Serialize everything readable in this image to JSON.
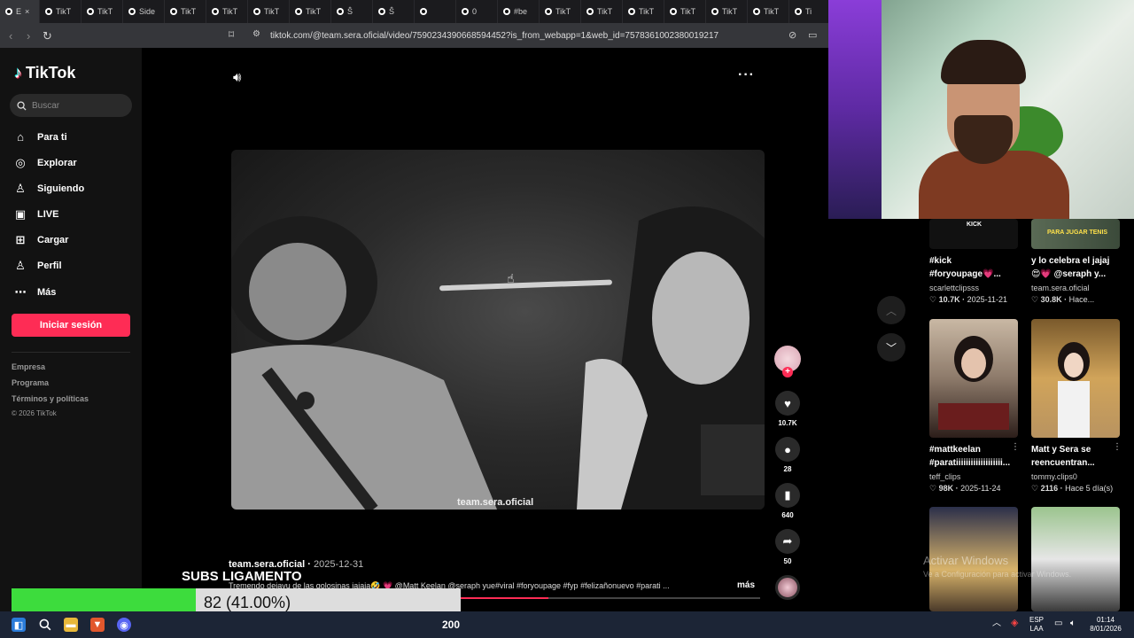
{
  "browser": {
    "tabs": [
      {
        "label": "E",
        "active": true
      },
      {
        "label": "TikT"
      },
      {
        "label": "TikT"
      },
      {
        "label": "Side"
      },
      {
        "label": "TikT"
      },
      {
        "label": "TikT"
      },
      {
        "label": "TikT"
      },
      {
        "label": "TikT"
      },
      {
        "label": "Ŝ"
      },
      {
        "label": "Ŝ"
      },
      {
        "label": ""
      },
      {
        "label": "0"
      },
      {
        "label": "#be"
      },
      {
        "label": "TikT"
      },
      {
        "label": "TikT"
      },
      {
        "label": "TikT"
      },
      {
        "label": "TikT"
      },
      {
        "label": "TikT"
      },
      {
        "label": "TikT"
      },
      {
        "label": "Ti"
      }
    ],
    "url": "tiktok.com/@team.sera.oficial/video/7590234390668594452?is_from_webapp=1&web_id=7578361002380019217"
  },
  "sidebar": {
    "logo": "TikTok",
    "search_placeholder": "Buscar",
    "nav": [
      {
        "label": "Para ti",
        "icon": "home-icon"
      },
      {
        "label": "Explorar",
        "icon": "compass-icon"
      },
      {
        "label": "Siguiendo",
        "icon": "following-icon"
      },
      {
        "label": "LIVE",
        "icon": "live-icon"
      },
      {
        "label": "Cargar",
        "icon": "upload-icon"
      },
      {
        "label": "Perfil",
        "icon": "profile-icon"
      },
      {
        "label": "Más",
        "icon": "more-icon"
      }
    ],
    "login_label": "Iniciar sesión",
    "footer_links": [
      "Empresa",
      "Programa",
      "Términos y políticas"
    ],
    "copyright": "© 2026 TikTok"
  },
  "video": {
    "watermark": "team.sera.oficial",
    "author": "team.sera.oficial",
    "date": "2025-12-31",
    "caption": "Tremendo dejavu de las golosinas jajaja🤣 💗 @Matt Keelan @seraph yue#viral #foryoupage #fyp #felizañonuevo #parati ...",
    "more_label": "más",
    "progress": 0.6,
    "actions": {
      "likes": "10.7K",
      "comments": "28",
      "saves": "640",
      "shares": "50"
    }
  },
  "suggestions": [
    {
      "title_line1": "#kick",
      "title_line2": "#foryoupage💗...",
      "user": "scarlettclipsss",
      "likes": "10.7K",
      "time": "2025-11-21",
      "thumb_label": "KICK"
    },
    {
      "title_line1": "y lo celebra el jajaj",
      "title_line2": "😍💗 @seraph y...",
      "user": "team.sera.oficial",
      "likes": "30.8K",
      "time": "Hace...",
      "thumb_label": "PARA JUGAR TENIS"
    },
    {
      "title_line1": "#mattkeelan",
      "title_line2": "#paratiiiiiiiiiiiiiiiiiii...",
      "user": "teff_clips",
      "likes": "98K",
      "time": "2025-11-24"
    },
    {
      "title_line1": "Matt y Sera se",
      "title_line2": "reencuentran...",
      "user": "tommy.clips0",
      "likes": "2116",
      "time": "Hace 5 día(s)"
    }
  ],
  "windows_notice": {
    "title": "Activar Windows",
    "subtitle": "Ve a Configuración para activar Windows."
  },
  "overlay": {
    "subs_label": "SUBS LIGAMENTO",
    "subs_text": "82 (41.00%)",
    "subs_fraction": 0.41
  },
  "taskbar": {
    "counter": "200",
    "lang_line1": "ESP",
    "lang_line2": "LAA",
    "time": "01:14",
    "date": "8/01/2026"
  },
  "colors": {
    "accent": "#fe2c55",
    "subs_fill": "#3ddc3d",
    "taskbar": "#1c2536"
  }
}
